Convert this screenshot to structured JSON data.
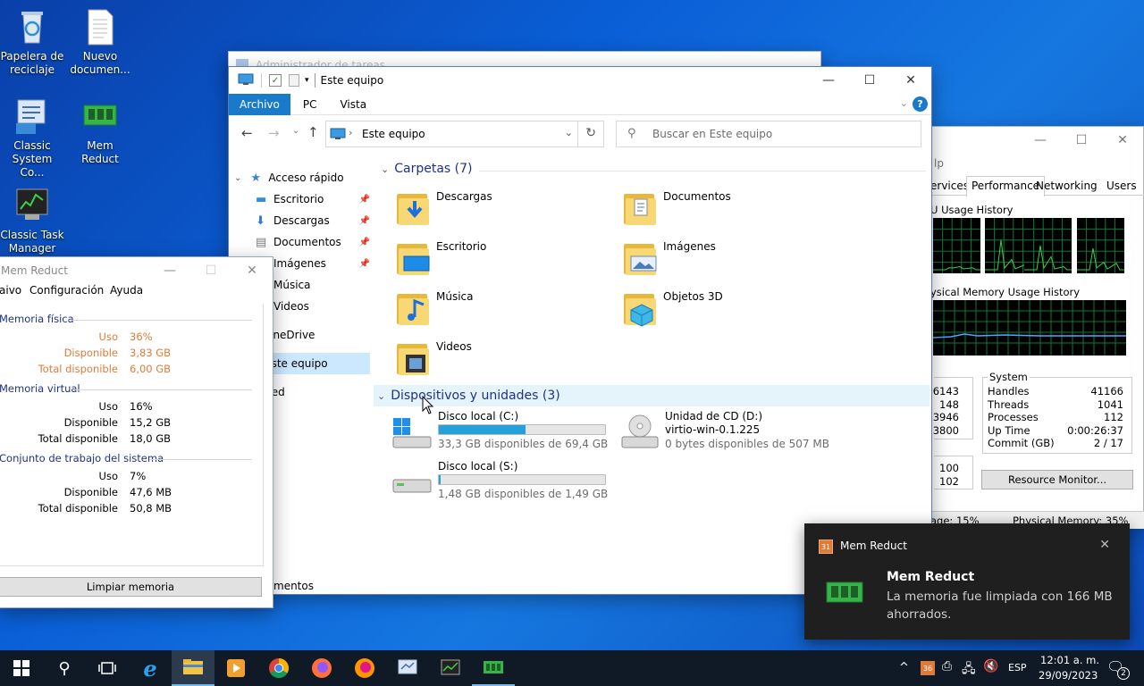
{
  "desktop": {
    "icons": [
      {
        "label": "Papelera de reciclaje"
      },
      {
        "label": "Nuevo documen..."
      },
      {
        "label": "Classic System Co..."
      },
      {
        "label": "Mem Reduct"
      },
      {
        "label": "Classic Task Manager"
      }
    ]
  },
  "bg_taskmgr": {
    "title": "Administrador de tareas"
  },
  "explorer": {
    "title": "Este equipo",
    "tabs": [
      "Archivo",
      "PC",
      "Vista"
    ],
    "address": "Este equipo",
    "search_placeholder": "Buscar en Este equipo",
    "nav": [
      {
        "label": "Acceso rápido"
      },
      {
        "label": "Escritorio"
      },
      {
        "label": "Descargas"
      },
      {
        "label": "Documentos"
      },
      {
        "label": "Imágenes"
      },
      {
        "label": "Música"
      },
      {
        "label": "Videos"
      },
      {
        "label": "OneDrive"
      },
      {
        "label": "Este equipo"
      },
      {
        "label": "Red"
      }
    ],
    "status": "mentos",
    "folders_header": "Carpetas (7)",
    "folders": [
      "Descargas",
      "Documentos",
      "Escritorio",
      "Imágenes",
      "Música",
      "Objetos 3D",
      "Videos"
    ],
    "devices_header": "Dispositivos y unidades (3)",
    "drives": [
      {
        "name": "Disco local (C:)",
        "info": "33,3 GB disponibles de 69,4 GB",
        "used": 0.52
      },
      {
        "name": "Unidad de CD (D:)",
        "sub": "virtio-win-0.1.225",
        "info": "0 bytes disponibles de 507 MB"
      },
      {
        "name": "Disco local (S:)",
        "info": "1,48 GB disponibles de 1,49 GB",
        "used": 0.01
      }
    ]
  },
  "classic_tm": {
    "tabs": [
      "ervices",
      "Performance",
      "Networking",
      "Users"
    ],
    "menu_frag": "lp",
    "cpu_label": "U Usage History",
    "mem_label": "ysical Memory Usage History",
    "left_vals": [
      "6143",
      "148",
      "3946",
      "3800"
    ],
    "left_vals2": [
      "100",
      "102"
    ],
    "system_title": "System",
    "system": [
      {
        "k": "Handles",
        "v": "41166"
      },
      {
        "k": "Threads",
        "v": "1041"
      },
      {
        "k": "Processes",
        "v": "112"
      },
      {
        "k": "Up Time",
        "v": "0:00:26:37"
      },
      {
        "k": "Commit (GB)",
        "v": "2 / 17"
      }
    ],
    "resource_btn": "Resource Monitor...",
    "status_left": "age: 15%",
    "status_right": "Physical Memory: 35%"
  },
  "memreduct": {
    "title": "Mem Reduct",
    "menu": [
      "aivo",
      "Configuración",
      "Ayuda"
    ],
    "sections": [
      {
        "title": "Memoria física",
        "rows": [
          {
            "k": "Uso",
            "v": "36%"
          },
          {
            "k": "Disponible",
            "v": "3,83 GB"
          },
          {
            "k": "Total disponible",
            "v": "6,00 GB"
          }
        ]
      },
      {
        "title": "Memoria virtual",
        "rows": [
          {
            "k": "Uso",
            "v": "16%"
          },
          {
            "k": "Disponible",
            "v": "15,2 GB"
          },
          {
            "k": "Total disponible",
            "v": "18,0 GB"
          }
        ]
      },
      {
        "title": "Conjunto de trabajo del sistema",
        "rows": [
          {
            "k": "Uso",
            "v": "7%"
          },
          {
            "k": "Disponible",
            "v": "47,6 MB"
          },
          {
            "k": "Total disponible",
            "v": "50,8 MB"
          }
        ]
      }
    ],
    "clean_btn": "Limpiar memoria",
    "accent": "#e07b39"
  },
  "toast": {
    "app": "Mem Reduct",
    "heading": "Mem Reduct",
    "body": "La memoria fue limpiada con 166 MB ahorrados."
  },
  "taskbar": {
    "lang": "ESP",
    "time": "12:01 a. m.",
    "date": "29/09/2023",
    "notif_count": "2"
  }
}
